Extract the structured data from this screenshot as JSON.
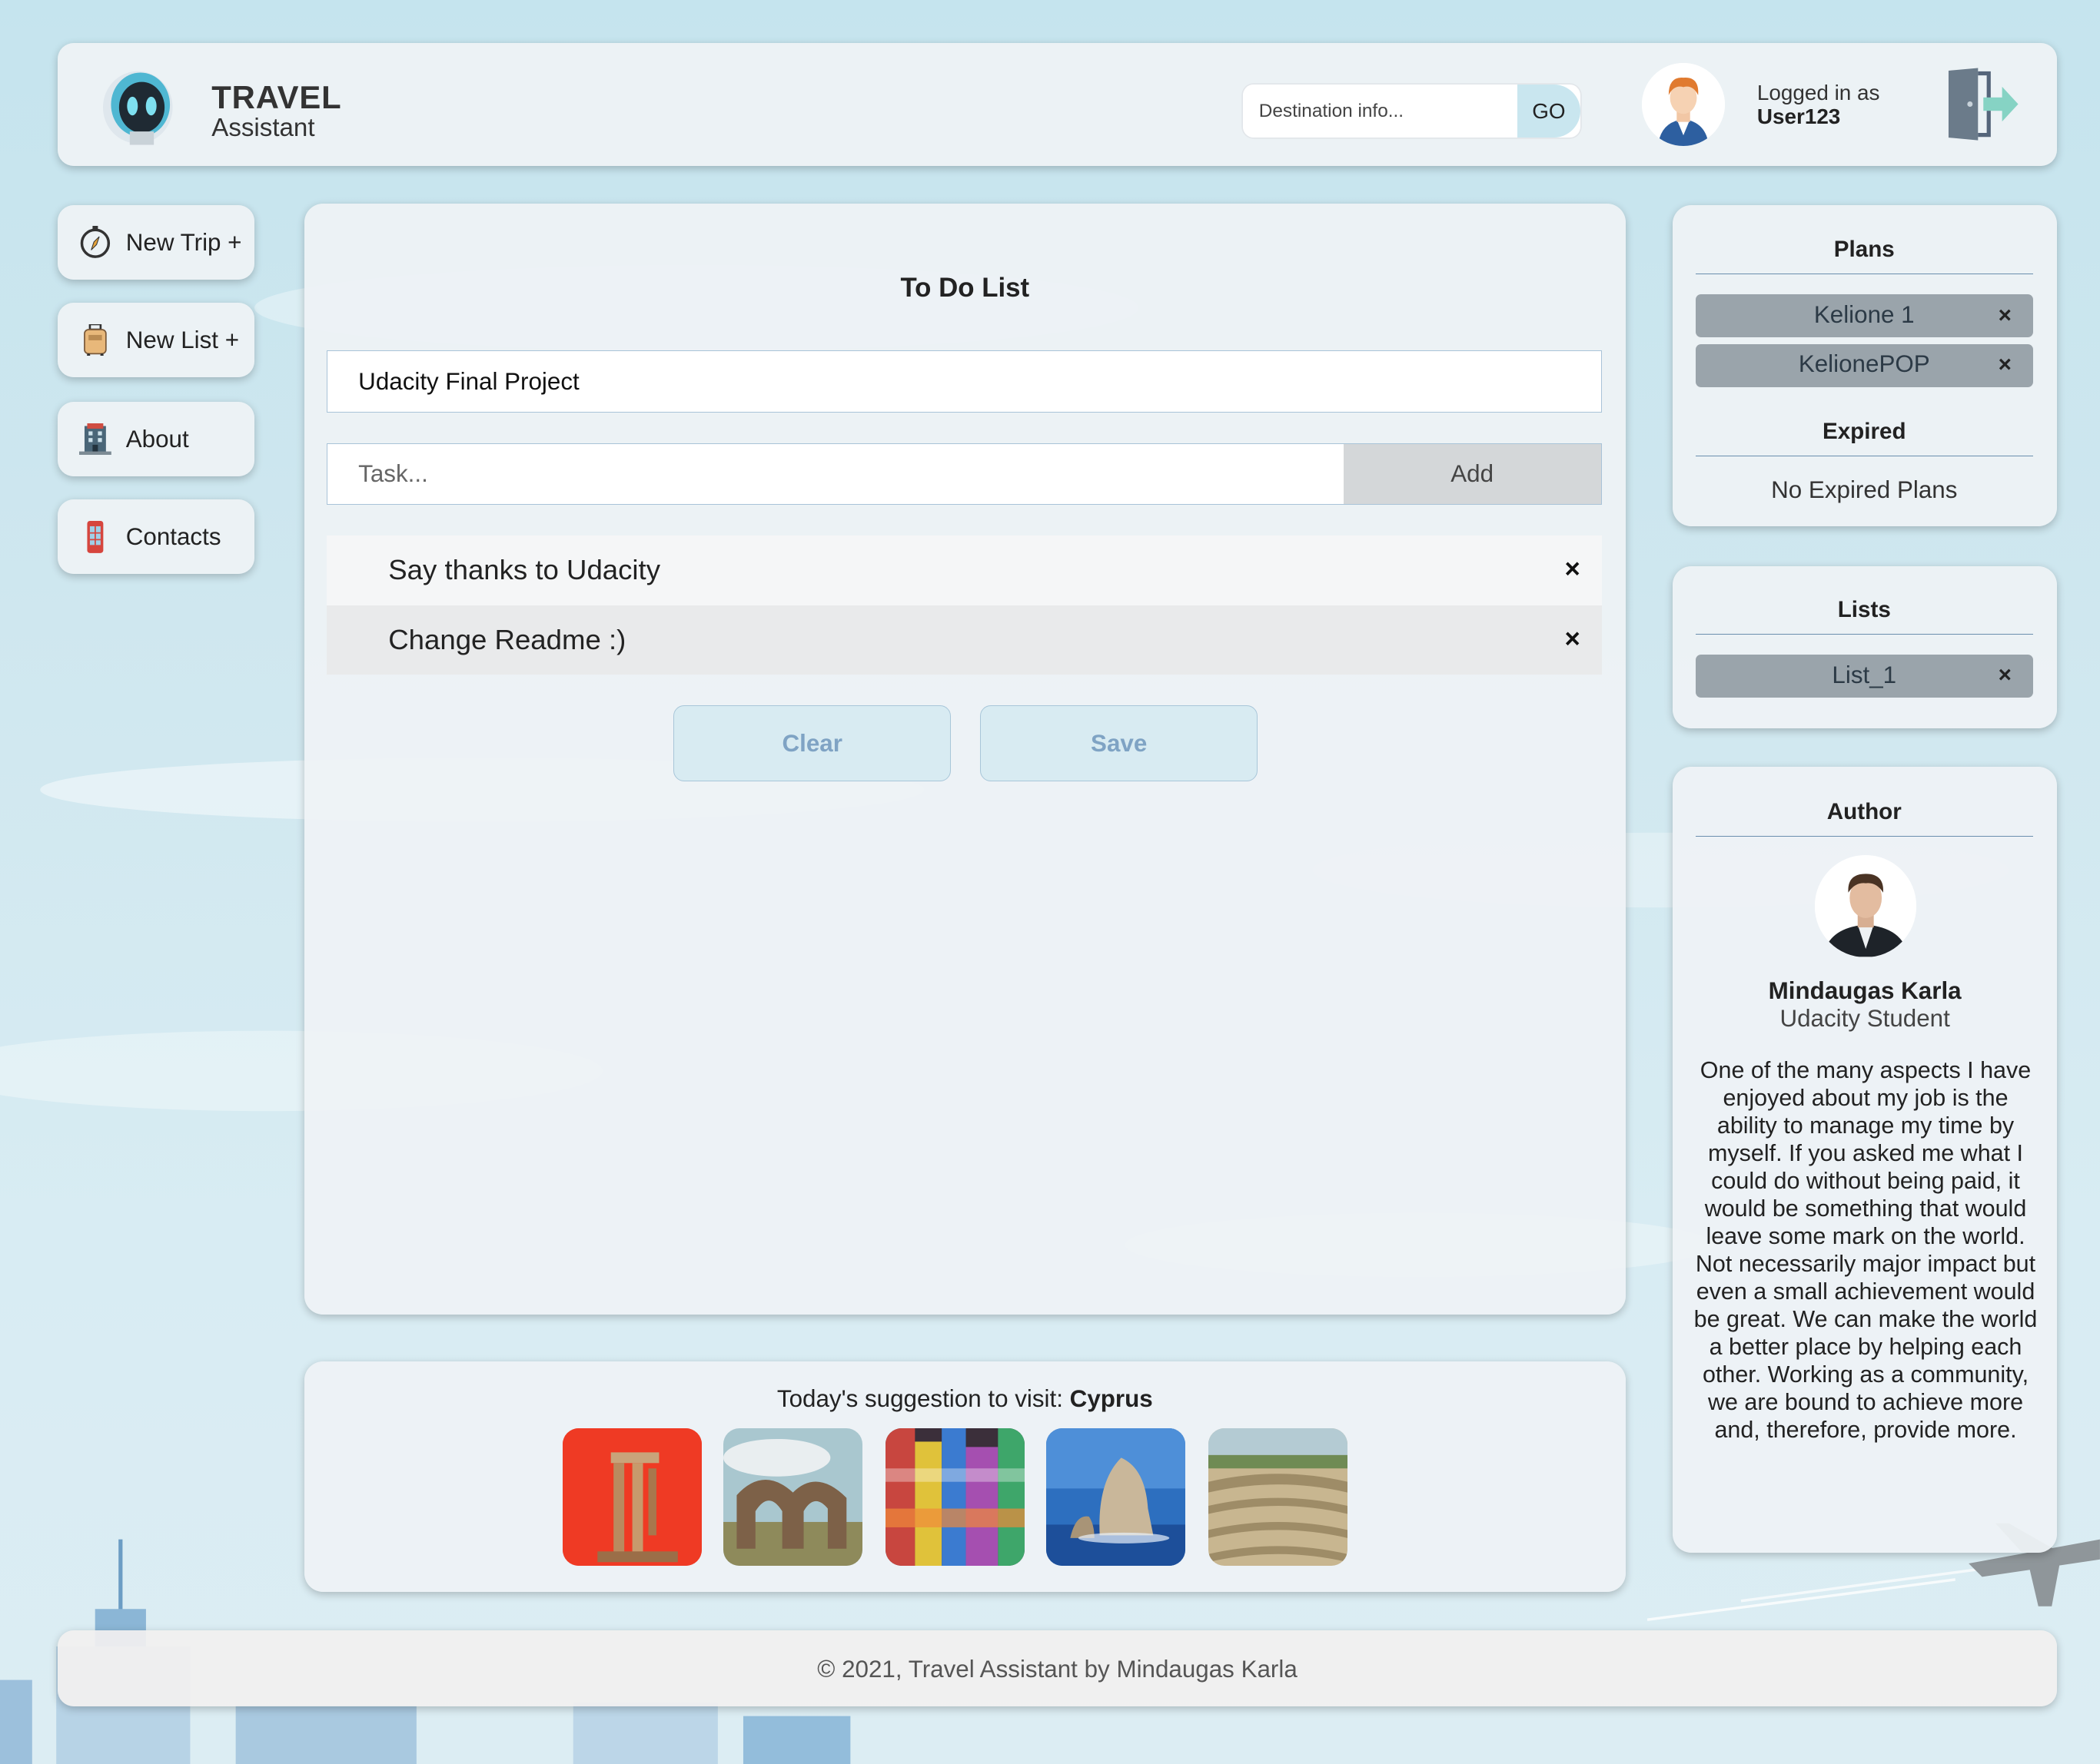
{
  "header": {
    "brand_title": "TRAVEL",
    "brand_subtitle": "Assistant",
    "search_placeholder": "Destination info...",
    "go_label": "GO",
    "logged_label": "Logged in as",
    "username": "User123",
    "icons": [
      "robot-logo-icon",
      "user-avatar-icon",
      "logout-icon"
    ]
  },
  "nav": {
    "items": [
      {
        "label": "New Trip +",
        "icon": "compass-icon"
      },
      {
        "label": "New List +",
        "icon": "luggage-icon"
      },
      {
        "label": "About",
        "icon": "building-icon"
      },
      {
        "label": "Contacts",
        "icon": "phone-booth-icon"
      }
    ]
  },
  "todo": {
    "title": "To Do List",
    "list_name_value": "Udacity Final Project",
    "task_placeholder": "Task...",
    "add_label": "Add",
    "tasks": [
      {
        "text": "Say thanks to Udacity",
        "remove": "×"
      },
      {
        "text": "Change Readme :)",
        "remove": "×"
      }
    ],
    "clear_label": "Clear",
    "save_label": "Save"
  },
  "suggestion": {
    "prefix": "Today's suggestion to visit: ",
    "place": "Cyprus",
    "thumbnails": [
      "temple-ruins-photo",
      "stone-arch-photo",
      "street-art-photo",
      "sea-rock-photo",
      "amphitheatre-photo"
    ]
  },
  "plans": {
    "title": "Plans",
    "items": [
      {
        "label": "Kelione 1",
        "remove": "×"
      },
      {
        "label": "KelionePOP",
        "remove": "×"
      }
    ],
    "expired_title": "Expired",
    "expired_empty": "No Expired Plans"
  },
  "lists": {
    "title": "Lists",
    "items": [
      {
        "label": "List_1",
        "remove": "×"
      }
    ]
  },
  "author": {
    "title": "Author",
    "name": "Mindaugas Karla",
    "role": "Udacity Student",
    "bio": "One of the many aspects I have enjoyed about my job is the ability to manage my time by myself. If you asked me what I could do without being paid, it would be something that would leave some mark on the world. Not necessarily major impact but even a small achievement would be great. We can make the world a better place by helping each other. Working as a community, we are bound to achieve more and, therefore, provide more."
  },
  "footer": {
    "text": "© 2021, Travel Assistant by Mindaugas Karla"
  },
  "colors": {
    "background": "#c5e4ee",
    "card": "#eef2f5",
    "pill": "#9aa4ab",
    "button_fill": "#d8ebf2",
    "button_text": "#7fa3c4",
    "accent_line": "#6b8fae"
  }
}
